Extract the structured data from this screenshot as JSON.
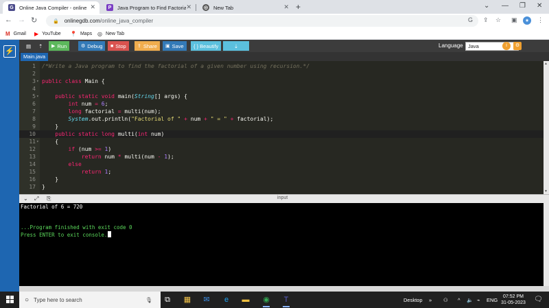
{
  "browser": {
    "tabs": [
      {
        "title": "Online Java Compiler - online ed",
        "active": true
      },
      {
        "title": "Java Program to Find Factorial of",
        "active": false
      },
      {
        "title": "New Tab",
        "active": false
      }
    ],
    "url_host": "onlinegdb.com",
    "url_path": "/online_java_compiler",
    "bookmarks": [
      "Gmail",
      "YouTube",
      "Maps",
      "New Tab"
    ]
  },
  "ide": {
    "toolbar": {
      "run": "Run",
      "debug": "Debug",
      "stop": "Stop",
      "share": "Share",
      "save": "Save",
      "beautify": "{ } Beautify",
      "language_label": "Language",
      "language_value": "Java"
    },
    "file_tab": "Main.java",
    "code_lines": [
      {
        "n": "1",
        "text": "/*Write a Java program to find the factorial of a given number using recursion.*/"
      },
      {
        "n": "2",
        "text": ""
      },
      {
        "n": "3",
        "text": "public class Main {"
      },
      {
        "n": "4",
        "text": ""
      },
      {
        "n": "5",
        "text": "    public static void main(String[] args) {"
      },
      {
        "n": "6",
        "text": "        int num = 6;"
      },
      {
        "n": "7",
        "text": "        long factorial = multi(num);"
      },
      {
        "n": "8",
        "text": "        System.out.println(\"Factorial of \" + num + \" = \" + factorial);"
      },
      {
        "n": "9",
        "text": "    }"
      },
      {
        "n": "10",
        "text": "    public static long multi(int num)"
      },
      {
        "n": "11",
        "text": "    {"
      },
      {
        "n": "12",
        "text": "        if (num >= 1)"
      },
      {
        "n": "13",
        "text": "            return num * multi(num - 1);"
      },
      {
        "n": "14",
        "text": "        else"
      },
      {
        "n": "15",
        "text": "            return 1;"
      },
      {
        "n": "16",
        "text": "    }"
      },
      {
        "n": "17",
        "text": "}"
      }
    ],
    "io_label": "input",
    "console_lines": [
      "Factorial of 6 = 720",
      "",
      "",
      "...Program finished with exit code 0",
      "Press ENTER to exit console."
    ]
  },
  "taskbar": {
    "search_placeholder": "Type here to search",
    "desktop_label": "Desktop",
    "lang": "ENG",
    "time": "07:52 PM",
    "date": "31-05-2023"
  }
}
